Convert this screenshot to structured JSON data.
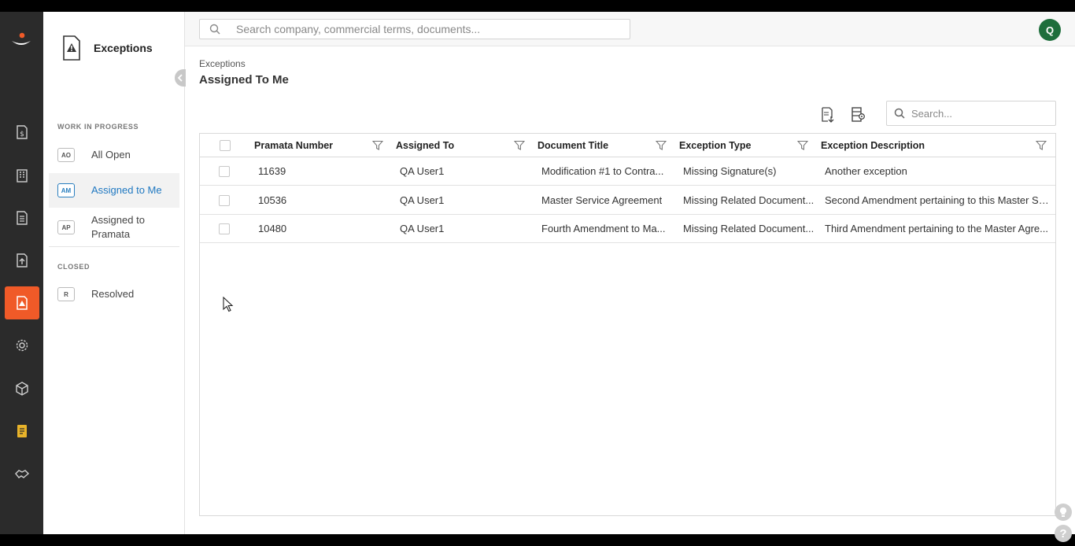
{
  "rail": {
    "items": [
      {
        "icon": "contract-dollar-icon"
      },
      {
        "icon": "building-icon"
      },
      {
        "icon": "document-icon"
      },
      {
        "icon": "upload-document-icon"
      },
      {
        "icon": "exceptions-icon",
        "active": true
      },
      {
        "icon": "settings-gear-icon"
      },
      {
        "icon": "box-icon"
      },
      {
        "icon": "notes-icon"
      },
      {
        "icon": "handshake-icon"
      }
    ],
    "active_color": "#f05a28"
  },
  "subnav": {
    "title": "Exceptions",
    "sections": [
      {
        "label": "WORK IN PROGRESS",
        "items": [
          {
            "badge": "AO",
            "label": "All Open"
          },
          {
            "badge": "AM",
            "label": "Assigned to Me",
            "active": true
          },
          {
            "badge": "AP",
            "label": "Assigned to Pramata"
          }
        ]
      },
      {
        "label": "CLOSED",
        "items": [
          {
            "badge": "R",
            "label": "Resolved"
          }
        ]
      }
    ]
  },
  "topbar": {
    "search_placeholder": "Search company, commercial terms, documents...",
    "avatar_initial": "Q",
    "avatar_color": "#1e6e3c"
  },
  "main": {
    "breadcrumb": "Exceptions",
    "title": "Assigned To Me",
    "search_placeholder": "Search...",
    "columns": [
      "Pramata Number",
      "Assigned To",
      "Document Title",
      "Exception Type",
      "Exception Description"
    ],
    "rows": [
      {
        "number": "11639",
        "assigned_to": "QA User1",
        "document_title": "Modification #1 to Contra...",
        "exception_type": "Missing Signature(s)",
        "description": "Another exception"
      },
      {
        "number": "10536",
        "assigned_to": "QA User1",
        "document_title": "Master Service Agreement",
        "exception_type": "Missing Related Document...",
        "description": "Second Amendment pertaining to this Master Se..."
      },
      {
        "number": "10480",
        "assigned_to": "QA User1",
        "document_title": "Fourth Amendment to Ma...",
        "exception_type": "Missing Related Document...",
        "description": "Third Amendment pertaining to the Master Agre..."
      }
    ]
  },
  "help": {
    "question_mark": "?"
  }
}
